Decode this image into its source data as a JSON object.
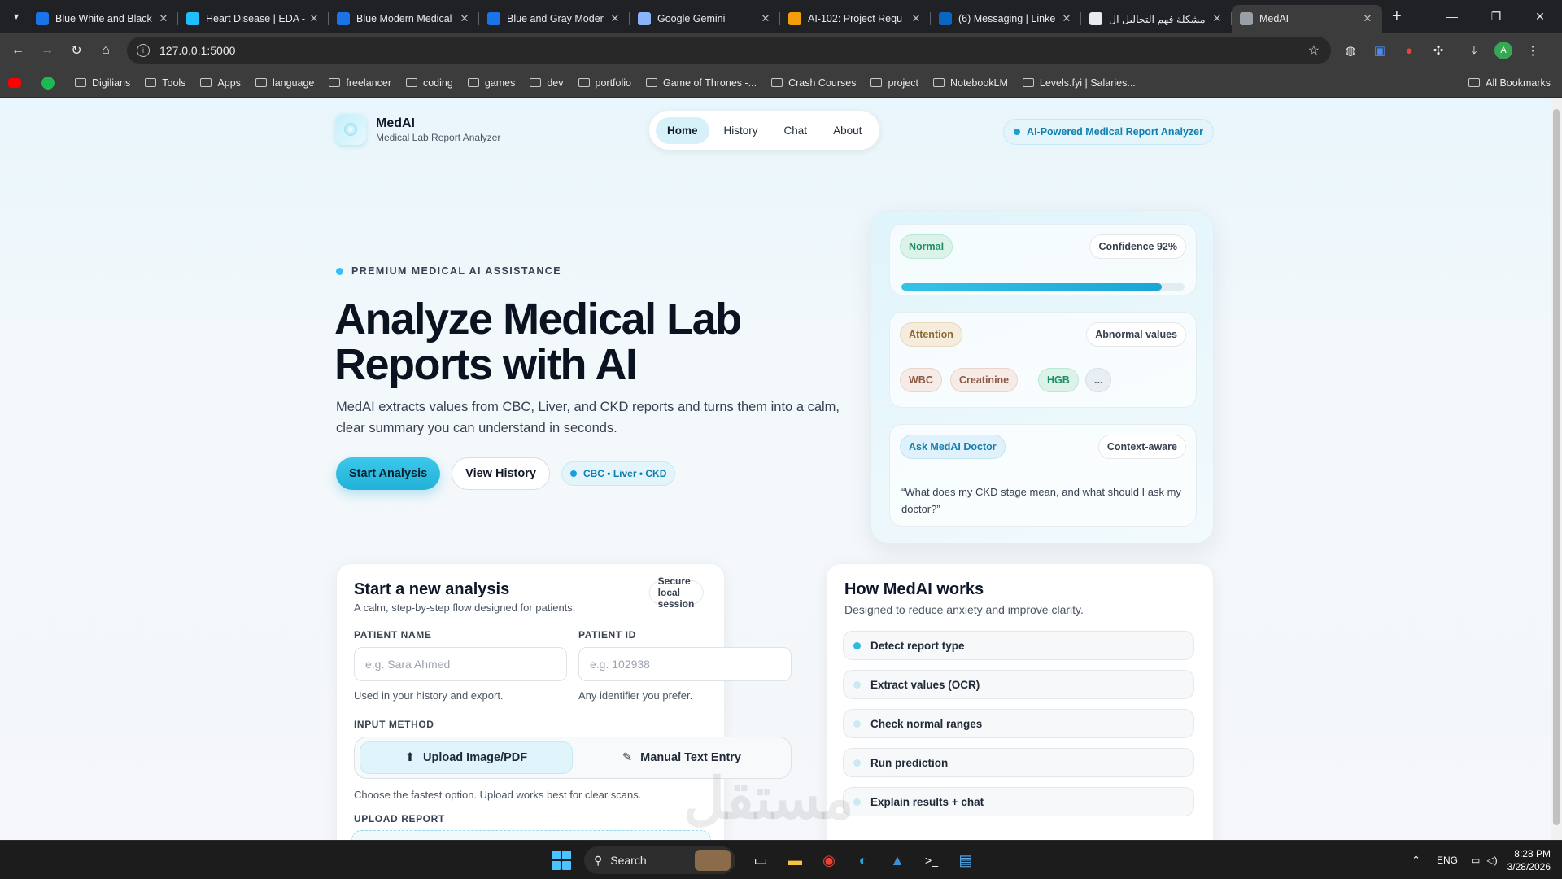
{
  "browser": {
    "tabs": [
      {
        "title": "Blue White and Black",
        "color": "#1a73e8",
        "active": false
      },
      {
        "title": "Heart Disease | EDA -",
        "color": "#20beff",
        "active": false
      },
      {
        "title": "Blue Modern Medical",
        "color": "#1a73e8",
        "active": false
      },
      {
        "title": "Blue and Gray Moder",
        "color": "#1a73e8",
        "active": false
      },
      {
        "title": "Google Gemini",
        "color": "#8ab4f8",
        "active": false
      },
      {
        "title": "AI-102: Project Requ",
        "color": "#f59e0b",
        "active": false
      },
      {
        "title": "(6) Messaging | Linke",
        "color": "#0a66c2",
        "active": false
      },
      {
        "title": "مشكلة فهم التحاليل ال",
        "color": "#e8eaed",
        "active": false
      },
      {
        "title": "MedAI",
        "color": "#9aa0a6",
        "active": true
      }
    ],
    "url": "127.0.0.1:5000",
    "bookmarks": [
      "Digilians",
      "Tools",
      "Apps",
      "language",
      "freelancer",
      "coding",
      "games",
      "dev",
      "portfolio",
      "Game of Thrones -...",
      "Crash Courses",
      "project",
      "NotebookLM",
      "Levels.fyi | Salaries..."
    ],
    "all_bookmarks": "All Bookmarks",
    "profile_initial": "A"
  },
  "header": {
    "brand_name": "MedAI",
    "brand_sub": "Medical Lab Report Analyzer",
    "nav": [
      "Home",
      "History",
      "Chat",
      "About"
    ],
    "active_nav": "Home",
    "badge": "AI-Powered Medical Report Analyzer"
  },
  "hero": {
    "eyebrow": "PREMIUM MEDICAL AI ASSISTANCE",
    "title": "Analyze Medical Lab Reports with AI",
    "lead": "MedAI extracts values from CBC, Liver, and CKD reports and turns them into a calm, clear summary you can understand in seconds.",
    "primary_cta": "Start Analysis",
    "secondary_cta": "View History",
    "chip": "CBC • Liver • CKD"
  },
  "preview": {
    "status": "Normal",
    "confidence": "Confidence 92%",
    "confidence_value": 0.92,
    "attention": "Attention",
    "abnormal": "Abnormal values",
    "markers": [
      "WBC",
      "Creatinine",
      "HGB",
      "..."
    ],
    "ask": "Ask MedAI Doctor",
    "context": "Context-aware",
    "quote": "“What does my CKD stage mean, and what should I ask my doctor?”"
  },
  "form": {
    "title": "Start a new analysis",
    "subtitle": "A calm, step-by-step flow designed for patients.",
    "secure": "Secure local session",
    "patient_name_label": "PATIENT NAME",
    "patient_name_placeholder": "e.g. Sara Ahmed",
    "patient_name_hint": "Used in your history and export.",
    "patient_id_label": "PATIENT ID",
    "patient_id_placeholder": "e.g. 102938",
    "patient_id_hint": "Any identifier you prefer.",
    "input_method_label": "INPUT METHOD",
    "upload_option": "Upload Image/PDF",
    "manual_option": "Manual Text Entry",
    "method_hint": "Choose the fastest option. Upload works best for clear scans.",
    "upload_label": "UPLOAD REPORT"
  },
  "how": {
    "title": "How MedAI works",
    "subtitle": "Designed to reduce anxiety and improve clarity.",
    "steps": [
      "Detect report type",
      "Extract values (OCR)",
      "Check normal ranges",
      "Run prediction",
      "Explain results + chat"
    ]
  },
  "watermark": "مستقل",
  "taskbar": {
    "search": "Search",
    "lang": "ENG",
    "time": "8:28 PM",
    "date": "3/28/2026"
  }
}
